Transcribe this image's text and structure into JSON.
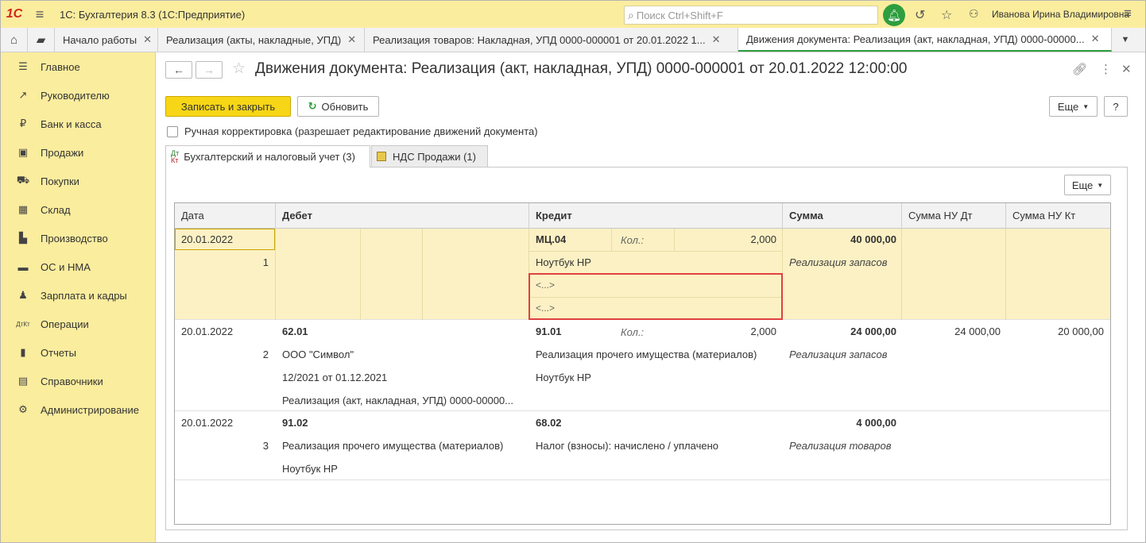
{
  "titlebar": {
    "logo": "1С",
    "title": "1С: Бухгалтерия 8.3  (1С:Предприятие)",
    "search_placeholder": "Поиск Ctrl+Shift+F",
    "user": "Иванова Ирина Владимировна"
  },
  "tabs": [
    {
      "label": "Начало работы"
    },
    {
      "label": "Реализация (акты, накладные, УПД)"
    },
    {
      "label": "Реализация товаров: Накладная, УПД 0000-000001 от 20.01.2022 1..."
    },
    {
      "label": "Движения документа: Реализация (акт, накладная, УПД) 0000-00000..."
    }
  ],
  "sidebar": {
    "items": [
      {
        "label": "Главное",
        "icon": "menu-icon"
      },
      {
        "label": "Руководителю",
        "icon": "trend-icon"
      },
      {
        "label": "Банк и касса",
        "icon": "ruble-icon"
      },
      {
        "label": "Продажи",
        "icon": "bag-icon"
      },
      {
        "label": "Покупки",
        "icon": "cart-icon"
      },
      {
        "label": "Склад",
        "icon": "warehouse-icon"
      },
      {
        "label": "Производство",
        "icon": "factory-icon"
      },
      {
        "label": "ОС и НМА",
        "icon": "truck-icon"
      },
      {
        "label": "Зарплата и кадры",
        "icon": "person-icon"
      },
      {
        "label": "Операции",
        "icon": "dtkt-icon"
      },
      {
        "label": "Отчеты",
        "icon": "bar-chart-icon"
      },
      {
        "label": "Справочники",
        "icon": "book-icon"
      },
      {
        "label": "Администрирование",
        "icon": "gear-icon"
      }
    ]
  },
  "form": {
    "title": "Движения документа: Реализация (акт, накладная, УПД) 0000-000001 от 20.01.2022 12:00:00",
    "save_close": "Записать и закрыть",
    "refresh": "Обновить",
    "more": "Еще",
    "help": "?",
    "manual_edit": "Ручная корректировка (разрешает редактирование движений документа)",
    "tab_accounting": "Бухгалтерский и налоговый учет (3)",
    "tab_vat": "НДС Продажи (1)",
    "tab_accounting_icon_top": "Дт",
    "tab_accounting_icon_bottom": "Кт",
    "grid_more": "Еще"
  },
  "grid": {
    "columns": {
      "date": "Дата",
      "debit": "Дебет",
      "credit": "Кредит",
      "sum": "Сумма",
      "sum_nu_dt": "Сумма НУ Дт",
      "sum_nu_kt": "Сумма НУ Кт"
    },
    "rows": [
      {
        "date": "20.01.2022",
        "num": "1",
        "debit_account": "",
        "credit_account": "МЦ.04",
        "qty_label": "Кол.:",
        "qty": "2,000",
        "credit_sub1": "Ноутбук HP",
        "credit_sub2": "<...>",
        "credit_sub3": "<...>",
        "sum": "40 000,00",
        "content": "Реализация запасов",
        "sum_nu_dt": "",
        "sum_nu_kt": ""
      },
      {
        "date": "20.01.2022",
        "num": "2",
        "debit_account": "62.01",
        "debit_sub1": "ООО \"Символ\"",
        "debit_sub2": "12/2021 от 01.12.2021",
        "debit_sub3": "Реализация (акт, накладная, УПД) 0000-00000...",
        "credit_account": "91.01",
        "qty_label": "Кол.:",
        "qty": "2,000",
        "credit_sub1": "Реализация прочего имущества (материалов)",
        "credit_sub2": "Ноутбук HP",
        "sum": "24 000,00",
        "content": "Реализация запасов",
        "sum_nu_dt": "24 000,00",
        "sum_nu_kt": "20 000,00"
      },
      {
        "date": "20.01.2022",
        "num": "3",
        "debit_account": "91.02",
        "debit_sub1": "Реализация прочего имущества (материалов)",
        "debit_sub2": "Ноутбук HP",
        "credit_account": "68.02",
        "credit_sub1": "Налог (взносы): начислено / уплачено",
        "sum": "4 000,00",
        "content": "Реализация товаров"
      }
    ]
  }
}
